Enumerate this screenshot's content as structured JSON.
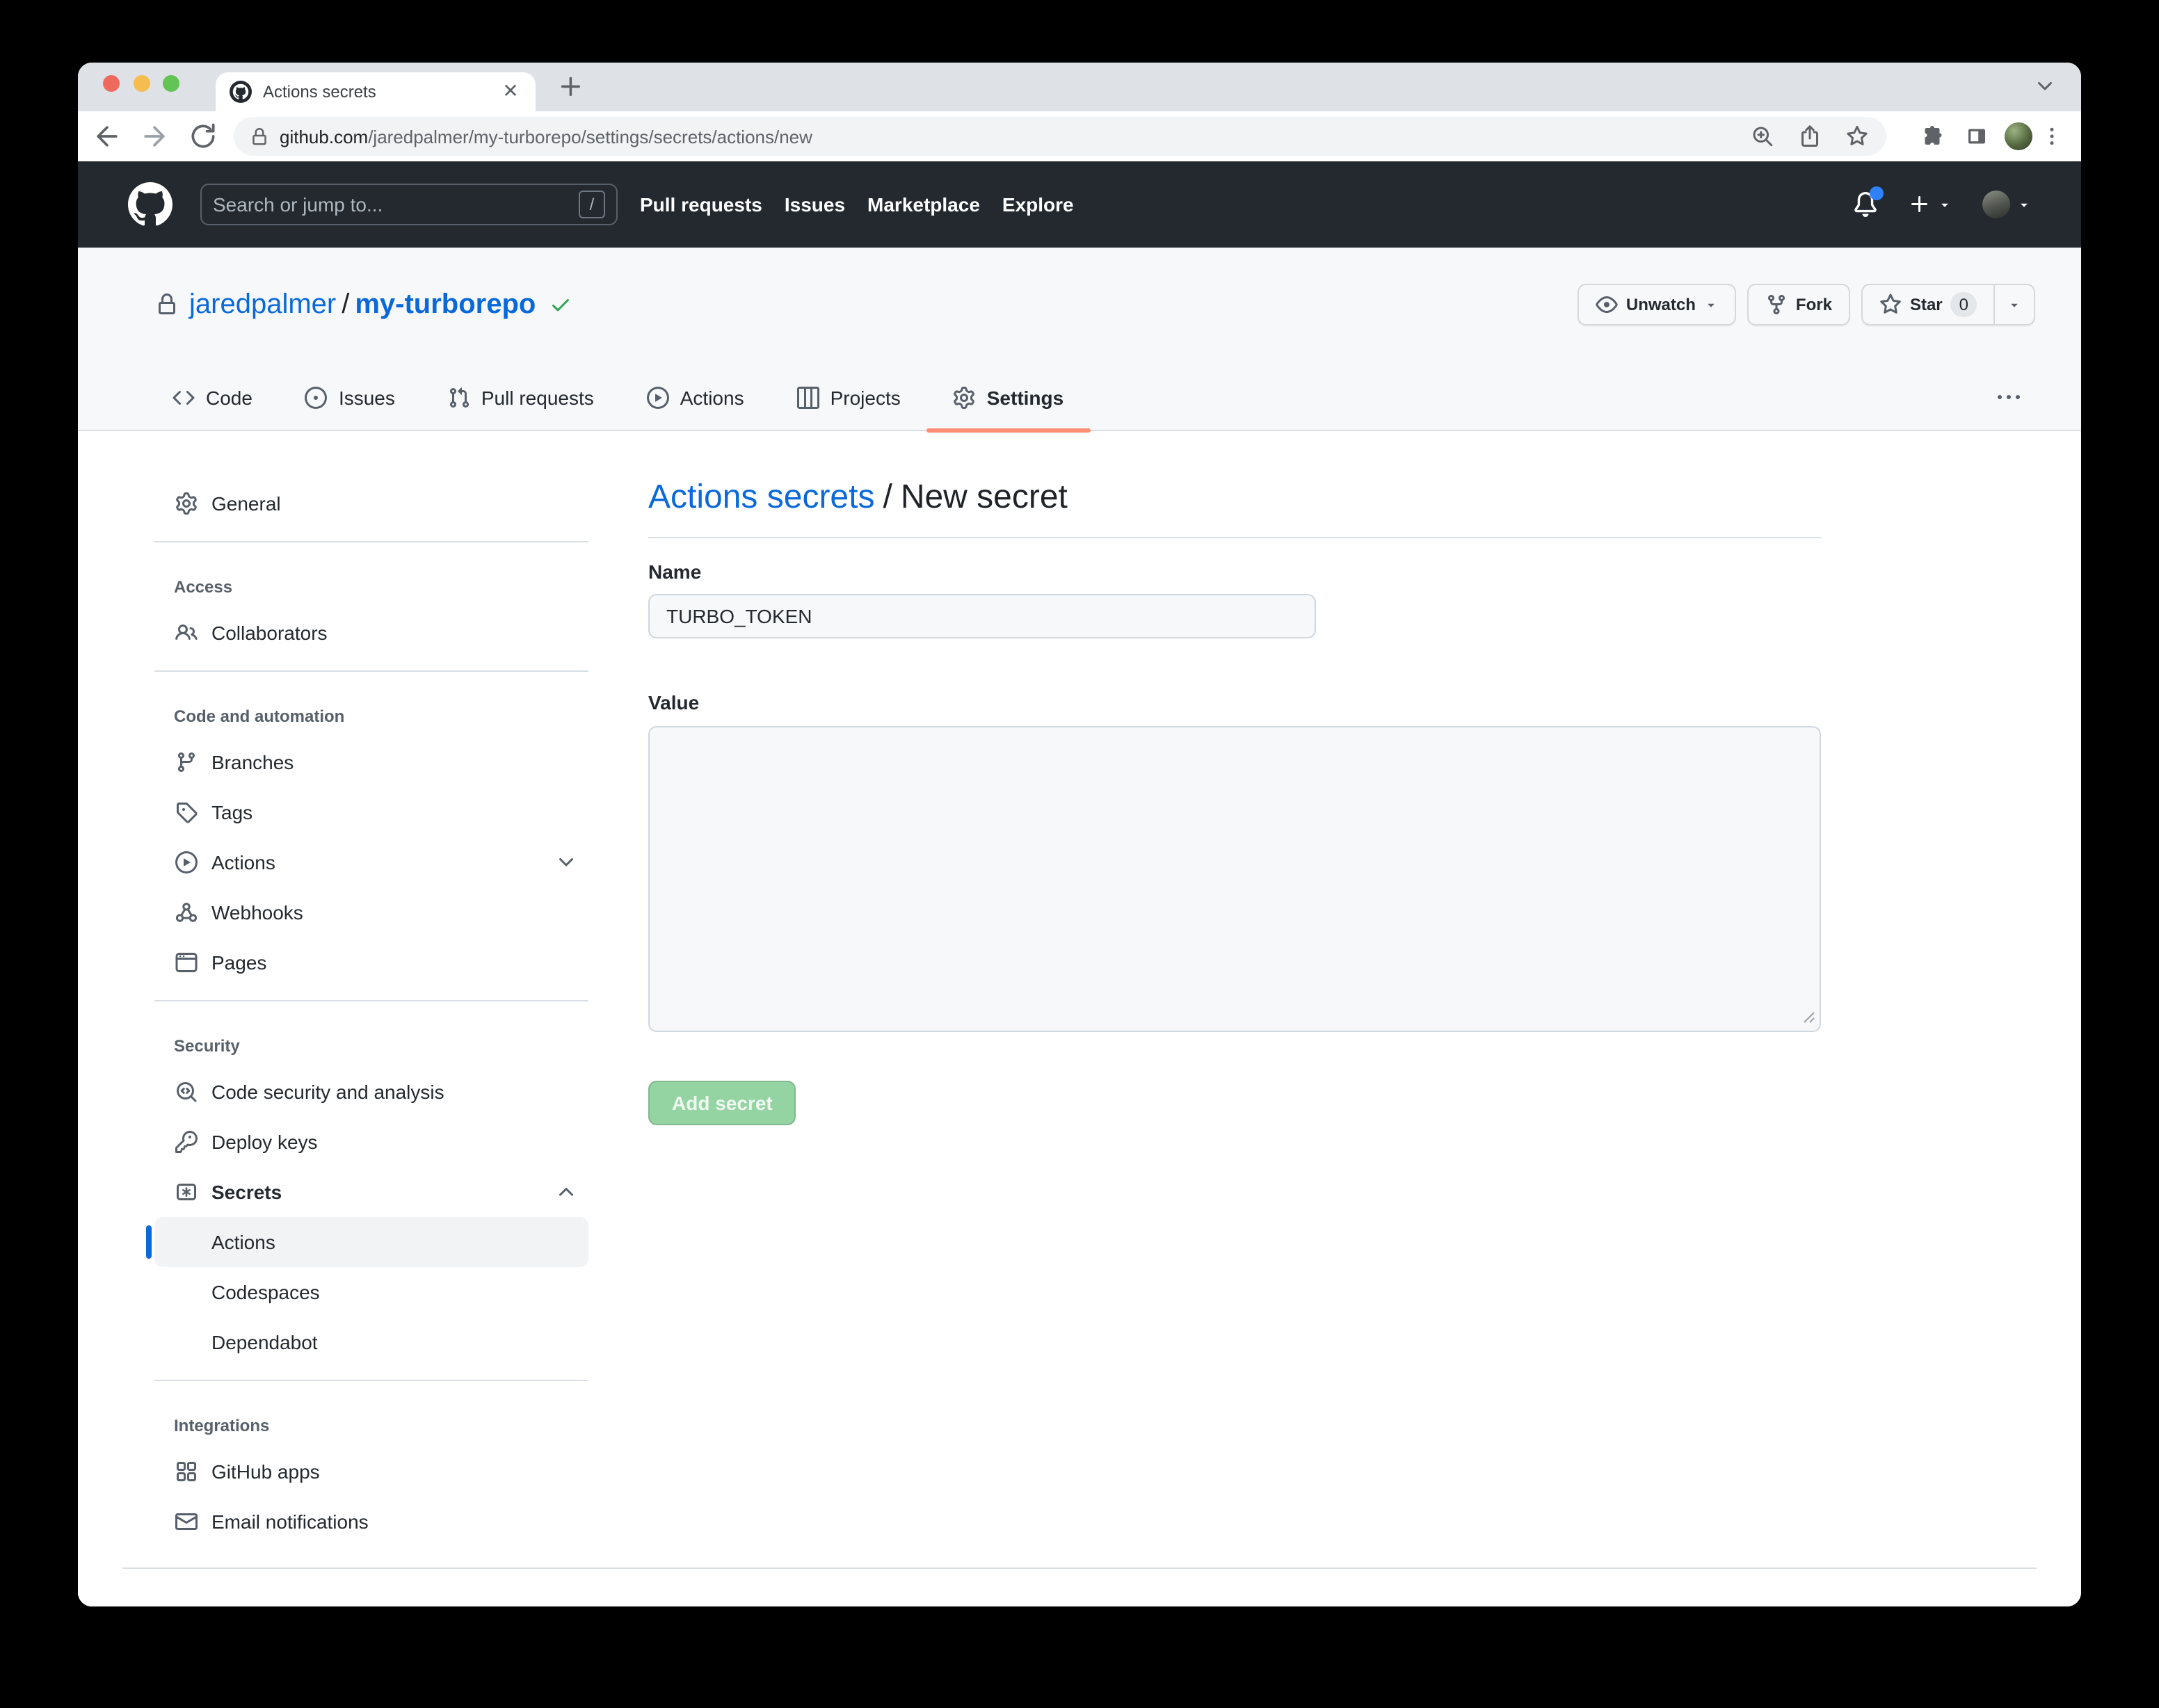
{
  "browser": {
    "window_controls": [
      "close",
      "minimize",
      "zoom"
    ],
    "tab": {
      "title": "Actions secrets",
      "favicon": "github-mark",
      "close_icon": "close"
    },
    "new_tab_icon": "plus",
    "tab_overflow_icon": "chevron-down",
    "toolbar": {
      "back_icon": "arrow-left",
      "forward_icon": "arrow-right",
      "reload_icon": "reload",
      "url": {
        "lock_icon": "lock",
        "domain": "github.com",
        "path": "/jaredpalmer/my-turborepo/settings/secrets/actions/new"
      },
      "omnibox_icons": [
        "zoom-in",
        "share",
        "bookmark-star"
      ],
      "right_icons": [
        "extensions",
        "side-panel"
      ],
      "avatar": "user-avatar",
      "menu_icon": "kebab-vertical"
    }
  },
  "gh_header": {
    "logo": "github-mark",
    "search": {
      "placeholder": "Search or jump to...",
      "key_hint": "/"
    },
    "nav": [
      {
        "label": "Pull requests"
      },
      {
        "label": "Issues"
      },
      {
        "label": "Marketplace"
      },
      {
        "label": "Explore"
      }
    ],
    "bell_icon": "bell",
    "has_notifications": true,
    "plus_icon": "plus",
    "caret_icon": "caret-down",
    "avatar": "user-avatar"
  },
  "repo": {
    "lock_icon": "lock",
    "owner": "jaredpalmer",
    "separator": "/",
    "name": "my-turborepo",
    "check_icon": "check",
    "actions": [
      {
        "label": "Unwatch",
        "icon": "eye",
        "caret": true
      },
      {
        "label": "Fork",
        "icon": "fork"
      },
      {
        "label": "Star",
        "icon": "star",
        "count": "0",
        "caret_segment": true
      }
    ],
    "tabs": [
      {
        "label": "Code",
        "icon": "code"
      },
      {
        "label": "Issues",
        "icon": "issue"
      },
      {
        "label": "Pull requests",
        "icon": "pr"
      },
      {
        "label": "Actions",
        "icon": "play"
      },
      {
        "label": "Projects",
        "icon": "project"
      },
      {
        "label": "Settings",
        "icon": "gear",
        "active": true
      }
    ],
    "overflow_icon": "kebab-horizontal"
  },
  "sidebar": {
    "items": [
      {
        "type": "item",
        "icon": "gear",
        "label": "General"
      },
      {
        "type": "divider"
      },
      {
        "type": "section",
        "label": "Access"
      },
      {
        "type": "item",
        "icon": "people",
        "label": "Collaborators"
      },
      {
        "type": "divider"
      },
      {
        "type": "section",
        "label": "Code and automation"
      },
      {
        "type": "item",
        "icon": "branch",
        "label": "Branches"
      },
      {
        "type": "item",
        "icon": "tag",
        "label": "Tags"
      },
      {
        "type": "item",
        "icon": "play",
        "label": "Actions",
        "chevron": "down"
      },
      {
        "type": "item",
        "icon": "webhook",
        "label": "Webhooks"
      },
      {
        "type": "item",
        "icon": "browser",
        "label": "Pages"
      },
      {
        "type": "divider"
      },
      {
        "type": "section",
        "label": "Security"
      },
      {
        "type": "item",
        "icon": "codescan",
        "label": "Code security and analysis"
      },
      {
        "type": "item",
        "icon": "key",
        "label": "Deploy keys"
      },
      {
        "type": "item",
        "icon": "secrets",
        "label": "Secrets",
        "bold": true,
        "chevron": "up"
      },
      {
        "type": "subitem",
        "label": "Actions",
        "active": true
      },
      {
        "type": "subitem",
        "label": "Codespaces"
      },
      {
        "type": "subitem",
        "label": "Dependabot"
      },
      {
        "type": "divider"
      },
      {
        "type": "section",
        "label": "Integrations"
      },
      {
        "type": "item",
        "icon": "apps",
        "label": "GitHub apps"
      },
      {
        "type": "item",
        "icon": "mail",
        "label": "Email notifications"
      }
    ]
  },
  "main": {
    "breadcrumb_link": "Actions secrets",
    "breadcrumb_sep": "/",
    "breadcrumb_current": "New secret",
    "name_label": "Name",
    "name_value": "TURBO_TOKEN",
    "value_label": "Value",
    "value_text": "",
    "submit_label": "Add secret"
  },
  "colors": {
    "accent_tab_underline": "#fd8c73",
    "link_blue": "#0969da",
    "sidebar_active_bar": "#0969da",
    "success_green": "#2da44e",
    "submit_disabled_bg": "#94d3a2",
    "header_dark": "#24292f"
  }
}
